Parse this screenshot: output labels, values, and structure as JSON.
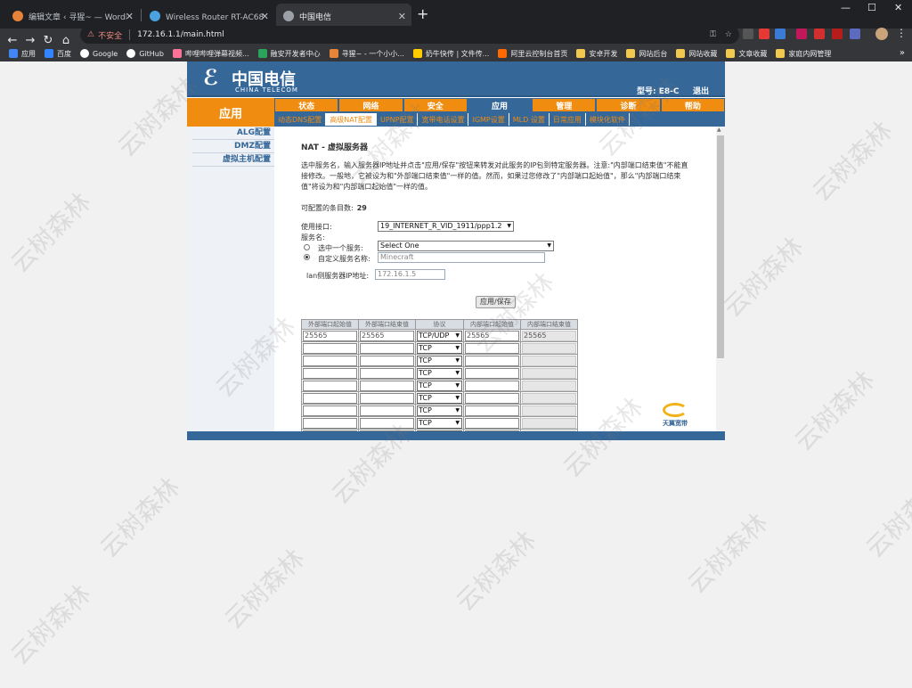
{
  "browser": {
    "tabs": [
      {
        "label": "编辑文章 ‹ 寻猩~ — WordPress",
        "color": "#e8833a"
      },
      {
        "label": "Wireless Router RT-AC68U - 网",
        "color": "#4aa3df"
      },
      {
        "label": "中国电信",
        "color": "#9aa0a6"
      }
    ],
    "window_controls": {
      "minimize": "—",
      "maximize": "☐",
      "close": "✕"
    },
    "nav": {
      "back": "←",
      "forward": "→",
      "reload": "↻",
      "home": "⌂"
    },
    "address": {
      "warning_icon": "⚠",
      "insecure_label": "不安全",
      "url": "172.16.1.1/main.html"
    },
    "bookmarks": [
      {
        "label": "应用",
        "icon": "apps-grid-icon",
        "color": "#4285f4"
      },
      {
        "label": "百度",
        "icon": "baidu-icon",
        "color": "#3385ff"
      },
      {
        "label": "Google",
        "icon": "google-icon",
        "color": "#ffffff"
      },
      {
        "label": "GitHub",
        "icon": "github-icon",
        "color": "#ffffff"
      },
      {
        "label": "哔哩哔哩弹幕视频...",
        "icon": "bilibili-icon",
        "color": "#fb7299"
      },
      {
        "label": "融安开发者中心",
        "icon": "green-circle-icon",
        "color": "#2ca35d"
      },
      {
        "label": "寻猩~ - 一个小小...",
        "icon": "orange-icon",
        "color": "#e8833a"
      },
      {
        "label": "奶牛快传 | 文件传...",
        "icon": "cow-icon",
        "color": "#ffcc00"
      },
      {
        "label": "阿里云控制台首页",
        "icon": "aliyun-icon",
        "color": "#ff6a00"
      },
      {
        "label": "安卓开发",
        "icon": "folder-icon",
        "color": "#f2c94c"
      },
      {
        "label": "网站后台",
        "icon": "folder-icon",
        "color": "#f2c94c"
      },
      {
        "label": "网站收藏",
        "icon": "folder-icon",
        "color": "#f2c94c"
      },
      {
        "label": "文章收藏",
        "icon": "folder-icon",
        "color": "#f2c94c"
      },
      {
        "label": "家庭内网管理",
        "icon": "folder-icon",
        "color": "#f2c94c"
      }
    ],
    "bookmarks_more": "»"
  },
  "router": {
    "logo_cn": "中国电信",
    "logo_en": "CHINA TELECOM",
    "model": "型号: E8-C",
    "logout": "退出",
    "section": "应用",
    "main_nav": [
      "状态",
      "网络",
      "安全",
      "应用",
      "管理",
      "诊断",
      "帮助"
    ],
    "main_nav_active": "应用",
    "sub_nav": [
      "动态DNS配置",
      "高级NAT配置",
      "UPNP配置",
      "宽带电话设置",
      "IGMP设置",
      "MLD 设置",
      "日常应用",
      "模块化软件"
    ],
    "sub_nav_active": "高级NAT配置",
    "left_nav": [
      "ALG配置",
      "DMZ配置",
      "虚拟主机配置"
    ],
    "page_title": "NAT - 虚拟服务器",
    "description": "选中服务名，输入服务器IP地址并点击\"应用/保存\"按钮来转发对此服务的IP包到特定服务器。注意:\"内部端口结束值\"不能直接修改。一般地，它被设为和\"外部端口结束值\"一样的值。然而，如果过您修改了\"内部端口起始值\"，那么\"内部端口结束值\"将设为和\"内部端口起始值\"一样的值。",
    "count_label": "可配置的条目数:",
    "count_value": "29",
    "interface_label": "使用接口:",
    "interface_value": "19_INTERNET_R_VID_1911/ppp1.2",
    "service_label": "服务名:",
    "select_service_label": "选中一个服务:",
    "select_service_value": "Select One",
    "custom_service_label": "自定义服务名称:",
    "custom_service_value": "Minecraft",
    "lan_ip_label": "lan侧服务器IP地址:",
    "lan_ip_value": "172.16.1.5",
    "apply_label": "应用/保存",
    "table": {
      "headers": [
        "外部端口起始值",
        "外部端口结束值",
        "协议",
        "内部端口起始值",
        "内部端口结束值"
      ],
      "rows": [
        [
          "25565",
          "25565",
          "TCP/UDP",
          "25565",
          "25565"
        ],
        [
          "",
          "",
          "TCP",
          "",
          ""
        ],
        [
          "",
          "",
          "TCP",
          "",
          ""
        ],
        [
          "",
          "",
          "TCP",
          "",
          ""
        ],
        [
          "",
          "",
          "TCP",
          "",
          ""
        ],
        [
          "",
          "",
          "TCP",
          "",
          ""
        ],
        [
          "",
          "",
          "TCP",
          "",
          ""
        ],
        [
          "",
          "",
          "TCP",
          "",
          ""
        ],
        [
          "",
          "",
          "TCP",
          "",
          ""
        ]
      ]
    },
    "tianyi_label": "天翼宽带"
  },
  "watermark": "云树森林",
  "colors": {
    "brand_blue": "#356799",
    "brand_orange": "#f08c10"
  }
}
